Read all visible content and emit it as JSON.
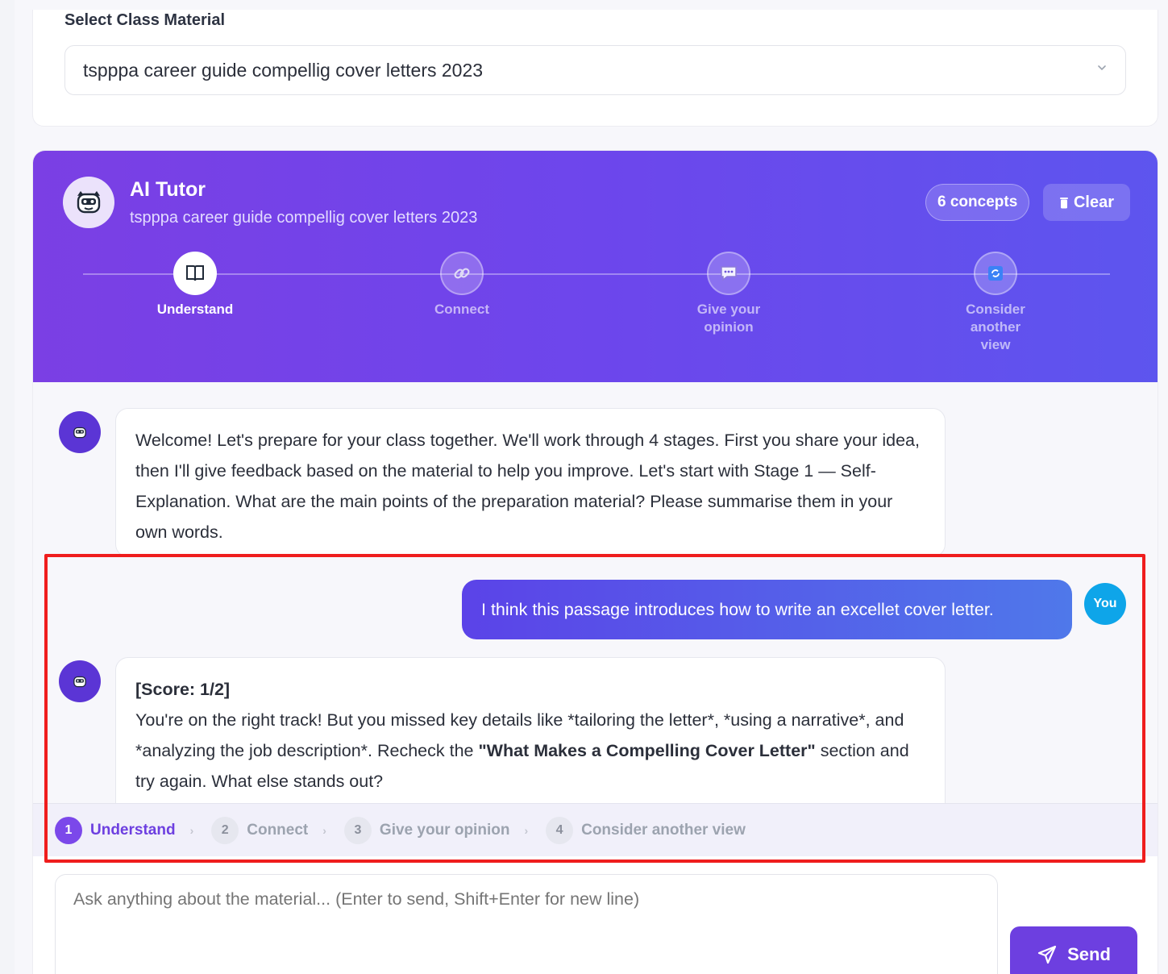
{
  "material": {
    "label": "Select Class Material",
    "selected": "tspppa career guide compellig cover letters 2023"
  },
  "tutor": {
    "title": "AI Tutor",
    "subtitle": "tspppa career guide compellig cover letters 2023",
    "concepts_badge": "6 concepts",
    "clear_label": "Clear"
  },
  "stepper": [
    {
      "label": "Understand",
      "icon": "book-icon",
      "active": true
    },
    {
      "label": "Connect",
      "icon": "link-icon",
      "active": false
    },
    {
      "label": "Give your opinion",
      "icon": "chat-bubble-icon",
      "active": false
    },
    {
      "label": "Consider another view",
      "icon": "refresh-icon",
      "active": false
    }
  ],
  "messages": {
    "welcome": "Welcome! Let's prepare for your class together. We'll work through 4 stages. First you share your idea, then I'll give feedback based on the material to help you improve. Let's start with Stage 1 — Self-Explanation. What are the main points of the preparation material? Please summarise them in your own words.",
    "user": "I think this passage introduces how to write an excellet cover letter.",
    "user_avatar": "You",
    "feedback_score": "[Score: 1/2]",
    "feedback_text_1": "You're on the right track! But you missed key details like *tailoring the letter*, *using a narrative*, and *analyzing the job description*. Recheck the ",
    "feedback_strong": "\"What Makes a Compelling Cover Letter\"",
    "feedback_text_2": " section and try again. What else stands out?"
  },
  "stages": [
    {
      "num": "1",
      "label": "Understand",
      "active": true
    },
    {
      "num": "2",
      "label": "Connect",
      "active": false
    },
    {
      "num": "3",
      "label": "Give your opinion",
      "active": false
    },
    {
      "num": "4",
      "label": "Consider another view",
      "active": false
    }
  ],
  "input": {
    "placeholder": "Ask anything about the material... (Enter to send, Shift+Enter for new line)",
    "send_label": "Send"
  },
  "colors": {
    "brand": "#6d3fe0",
    "highlight": "#ef1d1d",
    "user_avatar": "#0ea5e9"
  }
}
